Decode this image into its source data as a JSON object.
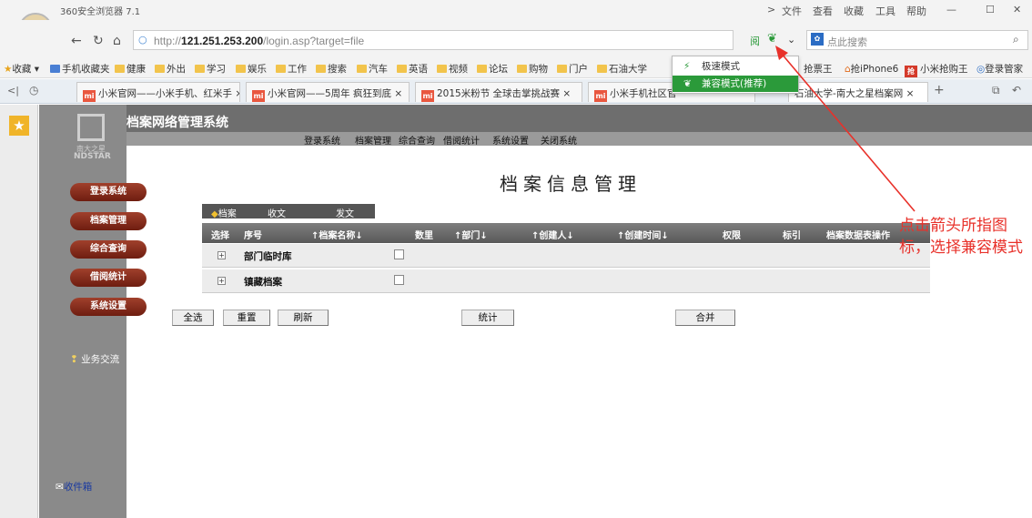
{
  "browser": {
    "title": "360安全浏览器 7.1",
    "menu": [
      "文件",
      "查看",
      "收藏",
      "工具",
      "帮助"
    ],
    "url_prefix": "http://",
    "url_host": "121.251.253.200",
    "url_path": "/login.asp?target=file",
    "search_placeholder": "点此搜索",
    "bookmarks": [
      "收藏",
      "手机收藏夹",
      "健康",
      "外出",
      "学习",
      "娱乐",
      "工作",
      "搜索",
      "汽车",
      "英语",
      "视频",
      "论坛",
      "购物",
      "门户",
      "石油大学"
    ],
    "bookmarks_right": [
      "抢票王",
      "抢iPhone6",
      "小米抢购王",
      "登录管家"
    ],
    "tabs": [
      "小米官网——小米手机、红米手",
      "小米官网——5周年 疯狂到底",
      "2015米粉节 全球击掌挑战赛",
      "小米手机社区官",
      "石油大学-南大之星档案网"
    ],
    "mode_menu": {
      "item1": "极速模式",
      "item2": "兼容模式(推荐)"
    }
  },
  "app": {
    "logo_text": "南大之星\nNDSTAR",
    "logo_cn": "南大之星",
    "logo_en": "NDSTAR",
    "title": "档案网络管理系统",
    "topnav": [
      "登录系统",
      "档案管理",
      "综合查询",
      "借阅统计",
      "系统设置",
      "关闭系统"
    ],
    "sidebar": [
      "登录系统",
      "档案管理",
      "综合查询",
      "借阅统计",
      "系统设置"
    ],
    "business": "业务交流",
    "inbox": "收件箱",
    "page_title": "档案信息管理",
    "subtabs": [
      "档案",
      "收文",
      "发文"
    ],
    "columns": [
      "选择",
      "序号",
      "↑档案名称↓",
      "数里",
      "↑部门↓",
      "↑创建人↓",
      "↑创建时间↓",
      "权限",
      "标引",
      "档案数据表操作"
    ],
    "rows": [
      {
        "name": "部门临时库"
      },
      {
        "name": "镇藏档案"
      }
    ],
    "buttons": {
      "select_all": "全选",
      "reset": "重置",
      "refresh": "刷新",
      "stats": "统计",
      "merge": "合并"
    }
  },
  "annotation": {
    "text": "点击箭头所指图标，选择兼容模式",
    "color": "#e8312a"
  },
  "colors": {
    "sidebar_button": "#8a2e1c",
    "header": "#6e6e6e",
    "compat_highlight": "#2b9a3a"
  }
}
